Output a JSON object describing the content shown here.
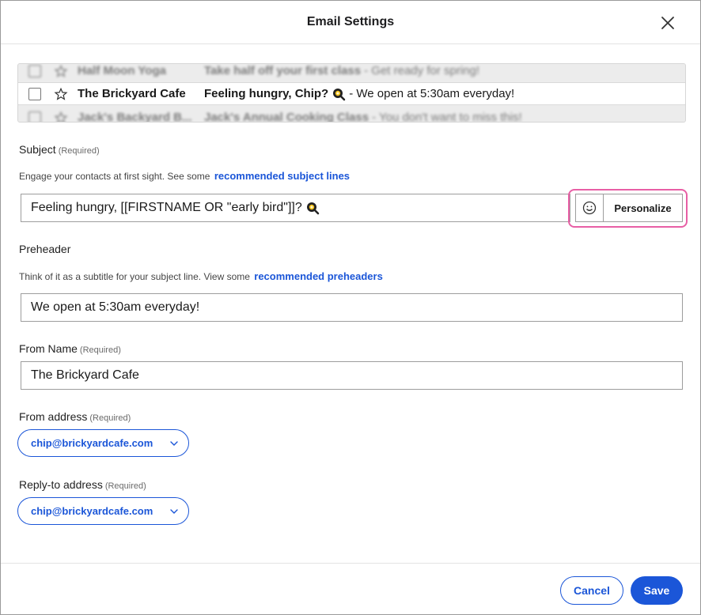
{
  "dialog": {
    "title": "Email Settings"
  },
  "preview": {
    "rows": [
      {
        "sender": "Half Moon Yoga",
        "subject": "Take half off your first class",
        "snippet": "- Get ready for spring!"
      },
      {
        "sender": "The Brickyard Cafe",
        "subject": "Feeling hungry, Chip?",
        "snippet": "- We open at 5:30am everyday!"
      },
      {
        "sender": "Jack's Backyard B...",
        "subject": "Jack's Annual Cooking Class",
        "snippet": "- You don't want to miss this!"
      }
    ]
  },
  "subject": {
    "label": "Subject",
    "required": "(Required)",
    "hint": "Engage your contacts at first sight. See some",
    "hint_link": "recommended subject lines",
    "value": "Feeling hungry, [[FIRSTNAME OR \"early bird\"]]?",
    "personalize_label": "Personalize"
  },
  "preheader": {
    "label": "Preheader",
    "hint": "Think of it as a subtitle for your subject line. View some",
    "hint_link": "recommended preheaders",
    "value": "We open at 5:30am everyday!"
  },
  "from_name": {
    "label": "From Name",
    "required": "(Required)",
    "value": "The Brickyard Cafe"
  },
  "from_address": {
    "label": "From address",
    "required": "(Required)",
    "value": "chip@brickyardcafe.com"
  },
  "reply_to": {
    "label": "Reply-to address",
    "required": "(Required)",
    "value": "chip@brickyardcafe.com"
  },
  "footer": {
    "cancel_label": "Cancel",
    "save_label": "Save"
  },
  "colors": {
    "accent": "#1b56d8",
    "highlight": "#e85fa5"
  }
}
